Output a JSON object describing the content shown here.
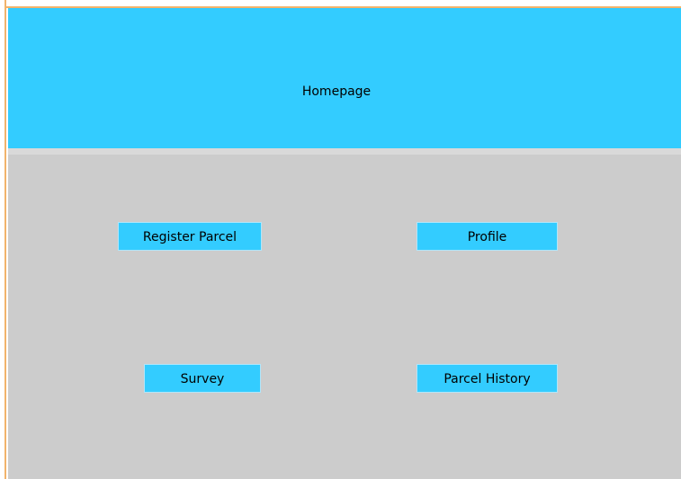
{
  "header": {
    "title": "Homepage"
  },
  "buttons": {
    "register_parcel": "Register Parcel",
    "profile": "Profile",
    "survey": "Survey",
    "parcel_history": "Parcel History"
  },
  "colors": {
    "accent": "#33ccff",
    "content_background": "#cccccc",
    "frame_border": "#f2b36b"
  }
}
